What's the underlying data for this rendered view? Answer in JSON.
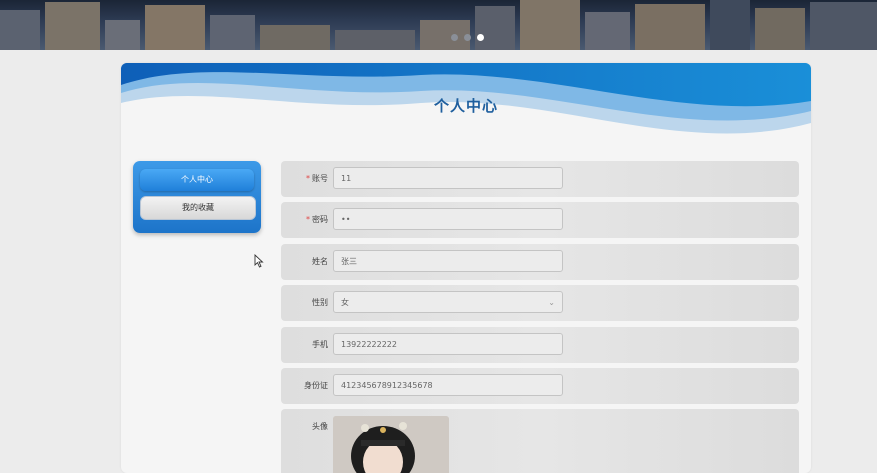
{
  "banner": {
    "carousel_dots": 3,
    "active_dot": 3
  },
  "card": {
    "title": "个人中心"
  },
  "menu": {
    "items": [
      {
        "label": "个人中心",
        "active": true
      },
      {
        "label": "我的收藏",
        "active": false
      }
    ]
  },
  "form": {
    "account": {
      "label": "账号",
      "required": "*",
      "value": "11"
    },
    "password": {
      "label": "密码",
      "required": "*",
      "value": "••"
    },
    "name": {
      "label": "姓名",
      "value": "张三"
    },
    "gender": {
      "label": "性别",
      "value": "女"
    },
    "phone": {
      "label": "手机",
      "value": "13922222222"
    },
    "idcard": {
      "label": "身份证",
      "value": "412345678912345678"
    },
    "avatar": {
      "label": "头像"
    }
  },
  "colors": {
    "accent": "#1d74c9",
    "title": "#1f5f9e",
    "required": "#e04646"
  }
}
